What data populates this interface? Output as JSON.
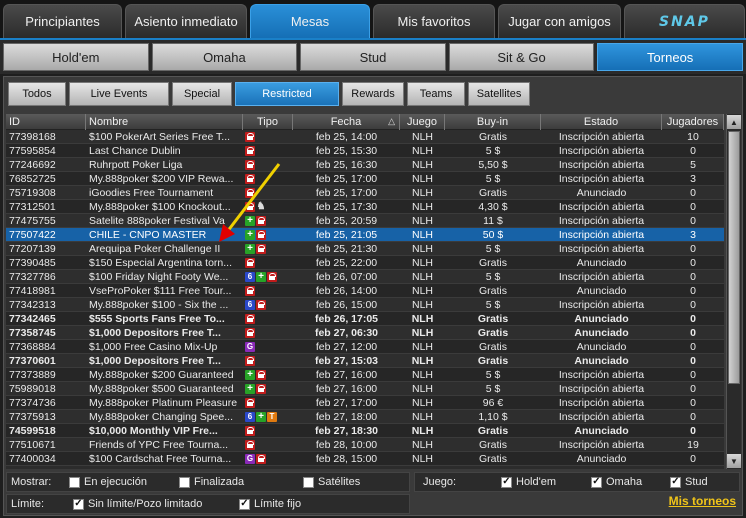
{
  "top_tabs": [
    "Principiantes",
    "Asiento inmediato",
    "Mesas",
    "Mis favoritos",
    "Jugar con amigos",
    "SNAP"
  ],
  "top_active": 2,
  "game_tabs": [
    "Hold'em",
    "Omaha",
    "Stud",
    "Sit & Go",
    "Torneos"
  ],
  "game_active": 4,
  "filters": [
    "Todos",
    "Live Events",
    "Special",
    "Restricted",
    "Rewards",
    "Teams",
    "Satellites"
  ],
  "filter_active": 3,
  "columns": {
    "id": "ID",
    "nombre": "Nombre",
    "tipo": "Tipo",
    "fecha": "Fecha",
    "juego": "Juego",
    "buyin": "Buy-in",
    "estado": "Estado",
    "jugadores": "Jugadores",
    "sort_arrow": "△"
  },
  "rows": [
    {
      "id": "77398168",
      "name": "$100 PokerArt Series Free T...",
      "icons": [
        "lock"
      ],
      "date": "feb 25, 14:00",
      "game": "NLH",
      "buyin": "Gratis",
      "status": "Inscripción abierta",
      "players": "10",
      "bold": false
    },
    {
      "id": "77595854",
      "name": "Last Chance Dublin",
      "icons": [
        "lock"
      ],
      "date": "feb 25, 15:30",
      "game": "NLH",
      "buyin": "5 $",
      "status": "Inscripción abierta",
      "players": "0",
      "bold": false
    },
    {
      "id": "77246692",
      "name": "Ruhrpott Poker Liga",
      "icons": [
        "lock"
      ],
      "date": "feb 25, 16:30",
      "game": "NLH",
      "buyin": "5,50 $",
      "status": "Inscripción abierta",
      "players": "5",
      "bold": false
    },
    {
      "id": "76852725",
      "name": "My.888poker $200 VIP Rewa...",
      "icons": [
        "lock"
      ],
      "date": "feb 25, 17:00",
      "game": "NLH",
      "buyin": "5 $",
      "status": "Inscripción abierta",
      "players": "3",
      "bold": false
    },
    {
      "id": "75719308",
      "name": "iGoodies Free Tournament",
      "icons": [
        "lock"
      ],
      "date": "feb 25, 17:00",
      "game": "NLH",
      "buyin": "Gratis",
      "status": "Anunciado",
      "players": "0",
      "bold": false
    },
    {
      "id": "77312501",
      "name": "My.888poker $100 Knockout...",
      "icons": [
        "lock",
        "knight"
      ],
      "date": "feb 25, 17:30",
      "game": "NLH",
      "buyin": "4,30 $",
      "status": "Inscripción abierta",
      "players": "0",
      "bold": false
    },
    {
      "id": "77475755",
      "name": "Satelite 888poker Festival Va",
      "icons": [
        "plus",
        "lock"
      ],
      "date": "feb 25, 20:59",
      "game": "NLH",
      "buyin": "11 $",
      "status": "Inscripción abierta",
      "players": "0",
      "bold": false
    },
    {
      "id": "77507422",
      "name": "CHILE - CNPO MASTER",
      "icons": [
        "plus",
        "lock"
      ],
      "date": "feb 25, 21:05",
      "game": "NLH",
      "buyin": "50 $",
      "status": "Inscripción abierta",
      "players": "3",
      "bold": false,
      "selected": true
    },
    {
      "id": "77207139",
      "name": "Arequipa Poker Challenge II",
      "icons": [
        "plus",
        "lock"
      ],
      "date": "feb 25, 21:30",
      "game": "NLH",
      "buyin": "5 $",
      "status": "Inscripción abierta",
      "players": "0",
      "bold": false
    },
    {
      "id": "77390485",
      "name": "$150 Especial Argentina torn...",
      "icons": [
        "lock"
      ],
      "date": "feb 25, 22:00",
      "game": "NLH",
      "buyin": "Gratis",
      "status": "Anunciado",
      "players": "0",
      "bold": false
    },
    {
      "id": "77327786",
      "name": "$100 Friday Night Footy We...",
      "icons": [
        "six",
        "plus",
        "lock"
      ],
      "date": "feb 26, 07:00",
      "game": "NLH",
      "buyin": "5 $",
      "status": "Inscripción abierta",
      "players": "0",
      "bold": false
    },
    {
      "id": "77418981",
      "name": "VseProPoker $111 Free Tour...",
      "icons": [
        "lock"
      ],
      "date": "feb 26, 14:00",
      "game": "NLH",
      "buyin": "Gratis",
      "status": "Anunciado",
      "players": "0",
      "bold": false
    },
    {
      "id": "77342313",
      "name": "My.888poker $100 - Six the ...",
      "icons": [
        "six",
        "lock"
      ],
      "date": "feb 26, 15:00",
      "game": "NLH",
      "buyin": "5 $",
      "status": "Inscripción abierta",
      "players": "0",
      "bold": false
    },
    {
      "id": "77342465",
      "name": "$555 Sports Fans Free To...",
      "icons": [
        "lock"
      ],
      "date": "feb 26, 17:05",
      "game": "NLH",
      "buyin": "Gratis",
      "status": "Anunciado",
      "players": "0",
      "bold": true
    },
    {
      "id": "77358745",
      "name": "$1,000 Depositors Free T...",
      "icons": [
        "lock"
      ],
      "date": "feb 27, 06:30",
      "game": "NLH",
      "buyin": "Gratis",
      "status": "Anunciado",
      "players": "0",
      "bold": true
    },
    {
      "id": "77368884",
      "name": "$1,000 Free Casino Mix-Up",
      "icons": [
        "g"
      ],
      "date": "feb 27, 12:00",
      "game": "NLH",
      "buyin": "Gratis",
      "status": "Anunciado",
      "players": "0",
      "bold": false
    },
    {
      "id": "77370601",
      "name": "$1,000 Depositors Free T...",
      "icons": [
        "lock"
      ],
      "date": "feb 27, 15:03",
      "game": "NLH",
      "buyin": "Gratis",
      "status": "Anunciado",
      "players": "0",
      "bold": true
    },
    {
      "id": "77373889",
      "name": "My.888poker $200 Guaranteed",
      "icons": [
        "plus",
        "lock"
      ],
      "date": "feb 27, 16:00",
      "game": "NLH",
      "buyin": "5 $",
      "status": "Inscripción abierta",
      "players": "0",
      "bold": false
    },
    {
      "id": "75989018",
      "name": "My.888poker $500 Guaranteed",
      "icons": [
        "plus",
        "lock"
      ],
      "date": "feb 27, 16:00",
      "game": "NLH",
      "buyin": "5 $",
      "status": "Inscripción abierta",
      "players": "0",
      "bold": false
    },
    {
      "id": "77374736",
      "name": "My.888poker Platinum Pleasure",
      "icons": [
        "lock"
      ],
      "date": "feb 27, 17:00",
      "game": "NLH",
      "buyin": "96 €",
      "status": "Inscripción abierta",
      "players": "0",
      "bold": false
    },
    {
      "id": "77375913",
      "name": "My.888poker Changing Spee...",
      "icons": [
        "six",
        "plus",
        "t"
      ],
      "date": "feb 27, 18:00",
      "game": "NLH",
      "buyin": "1,10 $",
      "status": "Inscripción abierta",
      "players": "0",
      "bold": false
    },
    {
      "id": "74599518",
      "name": "$10,000 Monthly VIP Fre...",
      "icons": [
        "lock"
      ],
      "date": "feb 27, 18:30",
      "game": "NLH",
      "buyin": "Gratis",
      "status": "Anunciado",
      "players": "0",
      "bold": true
    },
    {
      "id": "77510671",
      "name": "Friends of YPC Free Tourna...",
      "icons": [
        "lock"
      ],
      "date": "feb 28, 10:00",
      "game": "NLH",
      "buyin": "Gratis",
      "status": "Inscripción abierta",
      "players": "19",
      "bold": false
    },
    {
      "id": "77400034",
      "name": "$100 Cardschat Free Tourna...",
      "icons": [
        "g",
        "lock"
      ],
      "date": "feb 28, 15:00",
      "game": "NLH",
      "buyin": "Gratis",
      "status": "Anunciado",
      "players": "0",
      "bold": false
    }
  ],
  "bottom": {
    "mostrar_label": "Mostrar:",
    "mostrar": [
      {
        "label": "En ejecución",
        "checked": false
      },
      {
        "label": "Finalizada",
        "checked": false
      },
      {
        "label": "Satélites",
        "checked": false
      }
    ],
    "juego_label": "Juego:",
    "juego": [
      {
        "label": "Hold'em",
        "checked": true
      },
      {
        "label": "Omaha",
        "checked": true
      },
      {
        "label": "Stud",
        "checked": true
      }
    ],
    "limite_label": "Límite:",
    "limite": [
      {
        "label": "Sin límite/Pozo limitado",
        "checked": true
      },
      {
        "label": "Límite fijo",
        "checked": true
      }
    ],
    "link": "Mis torneos"
  },
  "icon_glyphs": {
    "six": "6",
    "plus": "+",
    "g": "G",
    "t": "T",
    "knight": "♞",
    "lock": ""
  },
  "colors": {
    "accent": "#1a80c8",
    "selected_row": "#1762a7",
    "link": "#f0c419",
    "arrow": "#f0d000"
  }
}
